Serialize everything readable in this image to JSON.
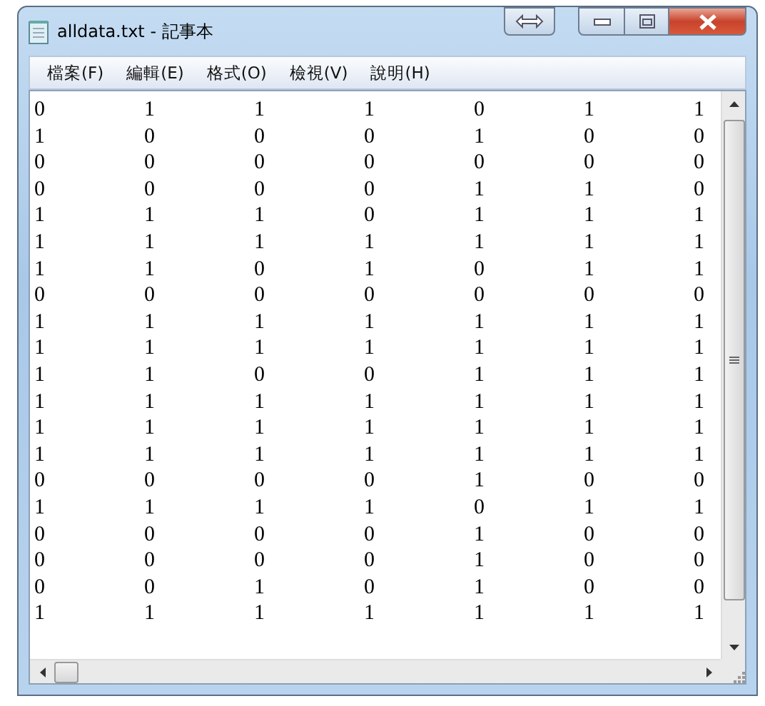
{
  "window": {
    "title": "alldata.txt - 記事本"
  },
  "menu": [
    {
      "label": "檔案(F)"
    },
    {
      "label": "編輯(E)"
    },
    {
      "label": "格式(O)"
    },
    {
      "label": "檢視(V)"
    },
    {
      "label": "說明(H)"
    }
  ],
  "document": {
    "lines": [
      "0\t1\t1\t1\t0\t1\t1",
      "1\t0\t0\t0\t1\t0\t0",
      "0\t0\t0\t0\t0\t0\t0",
      "0\t0\t0\t0\t1\t1\t0",
      "1\t1\t1\t0\t1\t1\t1",
      "1\t1\t1\t1\t1\t1\t1",
      "1\t1\t0\t1\t0\t1\t1",
      "0\t0\t0\t0\t0\t0\t0",
      "1\t1\t1\t1\t1\t1\t1",
      "1\t1\t1\t1\t1\t1\t1",
      "1\t1\t0\t0\t1\t1\t1",
      "1\t1\t1\t1\t1\t1\t1",
      "1\t1\t1\t1\t1\t1\t1",
      "1\t1\t1\t1\t1\t1\t1",
      "0\t0\t0\t0\t1\t0\t0",
      "1\t1\t1\t1\t0\t1\t1",
      "0\t0\t0\t0\t1\t0\t0",
      "0\t0\t0\t0\t1\t0\t0",
      "0\t0\t1\t0\t1\t0\t0",
      "1\t1\t1\t1\t1\t1\t1"
    ]
  }
}
